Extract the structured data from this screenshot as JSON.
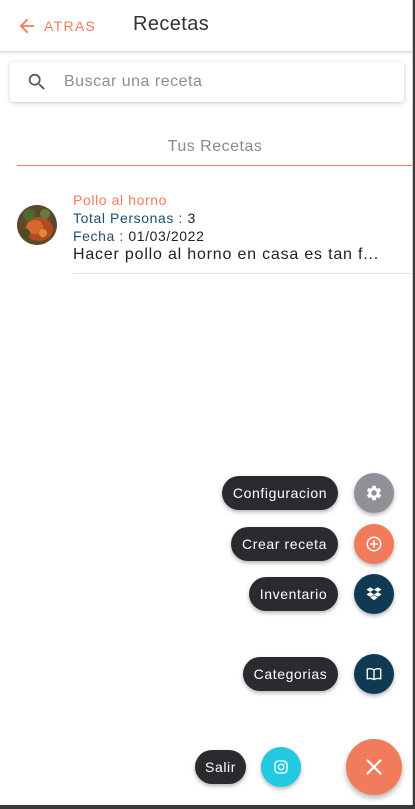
{
  "header": {
    "back_label": "ATRAS",
    "title": "Recetas"
  },
  "search": {
    "placeholder": "Buscar una receta",
    "value": ""
  },
  "section": {
    "tab_label": "Tus Recetas"
  },
  "recipes": [
    {
      "name": "Pollo al horno",
      "persons_label": "Total Personas : ",
      "persons_value": "3",
      "date_label": "Fecha : ",
      "date_value": "01/03/2022",
      "description": "Hacer pollo al horno en casa es tan f..."
    }
  ],
  "speed_dial": {
    "items": [
      {
        "label": "Configuracion",
        "icon": "gear-icon",
        "color": "#8f9196"
      },
      {
        "label": "Crear receta",
        "icon": "add-circle-icon",
        "color": "#f27b5c"
      },
      {
        "label": "Inventario",
        "icon": "dropbox-icon",
        "color": "#0f3a52"
      },
      {
        "label": "Categorias",
        "icon": "book-icon",
        "color": "#0f3a52"
      },
      {
        "label": "Salir",
        "icon": "instagram-icon",
        "color": "#22c9e0"
      }
    ],
    "main_icon": "close-icon",
    "main_color": "#f27b5c"
  },
  "colors": {
    "accent": "#f27b5c",
    "label_blue": "#1f4f6b",
    "dark": "#2b2b2f"
  }
}
